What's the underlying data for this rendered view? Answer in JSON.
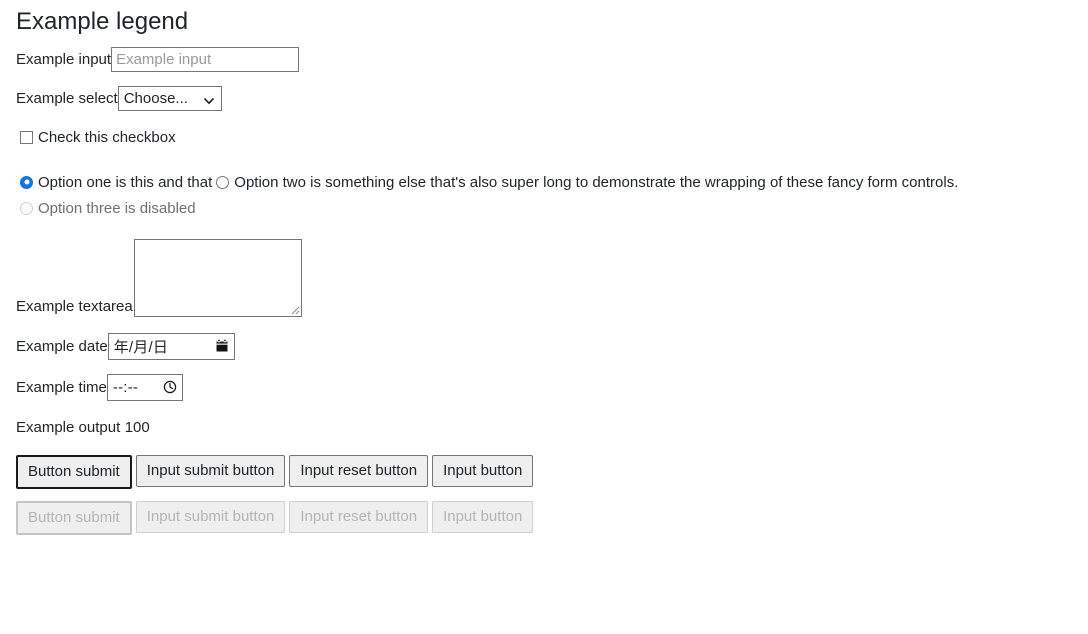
{
  "form": {
    "legend": "Example legend",
    "text_input": {
      "label": "Example input",
      "placeholder": "Example input",
      "value": ""
    },
    "select": {
      "label": "Example select",
      "selected": "Choose...",
      "arrow_icon": "chevron-down-icon"
    },
    "checkbox": {
      "label": "Check this checkbox",
      "checked": false
    },
    "radios": [
      {
        "label": "Option one is this and that",
        "checked": true,
        "disabled": false
      },
      {
        "label": "Option two is something else that's also super long to demonstrate the wrapping of these fancy form controls.",
        "checked": false,
        "disabled": false
      },
      {
        "label": "Option three is disabled",
        "checked": false,
        "disabled": true
      }
    ],
    "textarea": {
      "label": "Example textarea",
      "value": "",
      "resize_handle_icon": "resize-grip-icon"
    },
    "date": {
      "label": "Example date",
      "placeholder": "年/月/日",
      "icon": "calendar-icon"
    },
    "time": {
      "label": "Example time",
      "placeholder": "--:--",
      "icon": "clock-icon"
    },
    "output": {
      "label": "Example output",
      "value": "100"
    },
    "buttons_enabled": [
      {
        "label": "Button submit",
        "is_default": true
      },
      {
        "label": "Input submit button",
        "is_default": false
      },
      {
        "label": "Input reset button",
        "is_default": false
      },
      {
        "label": "Input button",
        "is_default": false
      }
    ],
    "buttons_disabled": [
      {
        "label": "Button submit",
        "is_default": true
      },
      {
        "label": "Input submit button",
        "is_default": false
      },
      {
        "label": "Input reset button",
        "is_default": false
      },
      {
        "label": "Input button",
        "is_default": false
      }
    ]
  },
  "colors": {
    "accent": "#1573e6",
    "text": "#212529",
    "border": "#767676",
    "placeholder": "#9a9a9a",
    "disabled_text": "#b5b5b5",
    "button_bg": "#efefef"
  }
}
